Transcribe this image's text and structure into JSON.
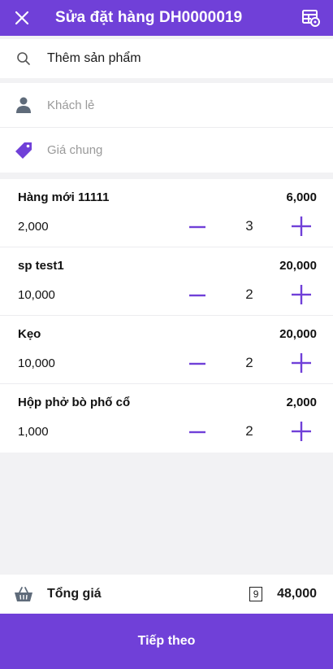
{
  "header": {
    "title": "Sửa đặt hàng DH0000019",
    "close_icon": "close-icon",
    "action_icon": "table-settings-icon"
  },
  "search": {
    "placeholder": "Thêm sản phẩm"
  },
  "customer": {
    "label": "Khách lẻ"
  },
  "price_list": {
    "label": "Giá chung"
  },
  "items": [
    {
      "name": "Hàng mới 11111",
      "total": "6,000",
      "price": "2,000",
      "qty": "3"
    },
    {
      "name": "sp test1",
      "total": "20,000",
      "price": "10,000",
      "qty": "2"
    },
    {
      "name": "Kẹo",
      "total": "20,000",
      "price": "10,000",
      "qty": "2"
    },
    {
      "name": "Hộp phở bò phố cổ",
      "total": "2,000",
      "price": "1,000",
      "qty": "2"
    }
  ],
  "summary": {
    "label": "Tổng giá",
    "count": "9",
    "amount": "48,000"
  },
  "next_button": {
    "label": "Tiếp theo"
  },
  "colors": {
    "accent": "#7040d8",
    "icon_gray": "#5f6b7a"
  }
}
